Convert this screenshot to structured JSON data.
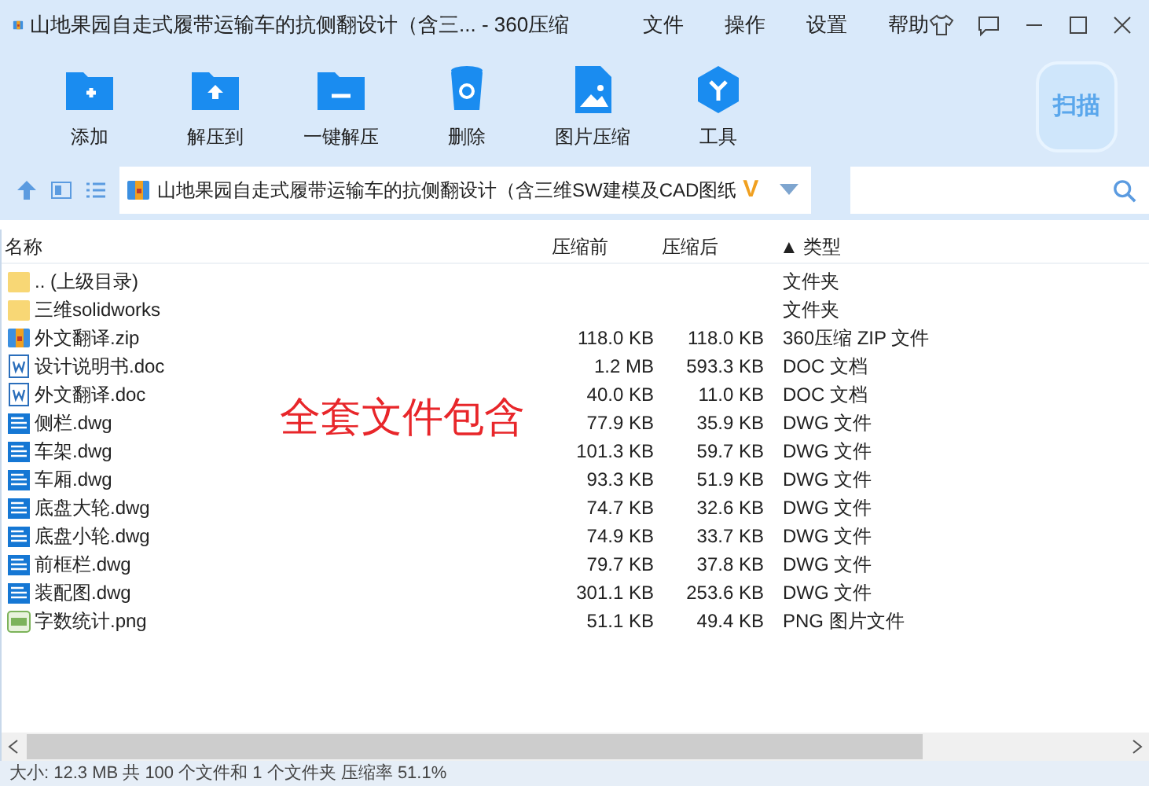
{
  "window": {
    "title": "山地果园自走式履带运输车的抗侧翻设计（含三... - 360压缩"
  },
  "menu": [
    "文件",
    "操作",
    "设置",
    "帮助"
  ],
  "toolbar": [
    {
      "kind": "add",
      "label": "添加"
    },
    {
      "kind": "extract",
      "label": "解压到"
    },
    {
      "kind": "oneclick",
      "label": "一键解压"
    },
    {
      "kind": "delete",
      "label": "删除"
    },
    {
      "kind": "image",
      "label": "图片压缩"
    },
    {
      "kind": "tools",
      "label": "工具"
    }
  ],
  "scan_badge": "扫描",
  "address": {
    "path": "山地果园自走式履带运输车的抗侧翻设计（含三维SW建模及CAD图纸",
    "badge": "V"
  },
  "table": {
    "columns": [
      "名称",
      "压缩前",
      "压缩后",
      "▲ 类型"
    ],
    "rows": [
      {
        "kind": "folder",
        "name": ".. (上级目录)",
        "size": "",
        "packed": "",
        "type": "文件夹"
      },
      {
        "kind": "folder",
        "name": "三维solidworks",
        "size": "",
        "packed": "",
        "type": "文件夹"
      },
      {
        "kind": "zip",
        "name": "外文翻译.zip",
        "size": "118.0 KB",
        "packed": "118.0 KB",
        "type": "360压缩 ZIP 文件"
      },
      {
        "kind": "doc",
        "name": "设计说明书.doc",
        "size": "1.2 MB",
        "packed": "593.3 KB",
        "type": "DOC 文档"
      },
      {
        "kind": "doc",
        "name": "外文翻译.doc",
        "size": "40.0 KB",
        "packed": "11.0 KB",
        "type": "DOC 文档"
      },
      {
        "kind": "dwg",
        "name": "侧栏.dwg",
        "size": "77.9 KB",
        "packed": "35.9 KB",
        "type": "DWG 文件"
      },
      {
        "kind": "dwg",
        "name": "车架.dwg",
        "size": "101.3 KB",
        "packed": "59.7 KB",
        "type": "DWG 文件"
      },
      {
        "kind": "dwg",
        "name": "车厢.dwg",
        "size": "93.3 KB",
        "packed": "51.9 KB",
        "type": "DWG 文件"
      },
      {
        "kind": "dwg",
        "name": "底盘大轮.dwg",
        "size": "74.7 KB",
        "packed": "32.6 KB",
        "type": "DWG 文件"
      },
      {
        "kind": "dwg",
        "name": "底盘小轮.dwg",
        "size": "74.9 KB",
        "packed": "33.7 KB",
        "type": "DWG 文件"
      },
      {
        "kind": "dwg",
        "name": "前框栏.dwg",
        "size": "79.7 KB",
        "packed": "37.8 KB",
        "type": "DWG 文件"
      },
      {
        "kind": "dwg",
        "name": "装配图.dwg",
        "size": "301.1 KB",
        "packed": "253.6 KB",
        "type": "DWG 文件"
      },
      {
        "kind": "png",
        "name": "字数统计.png",
        "size": "51.1 KB",
        "packed": "49.4 KB",
        "type": "PNG 图片文件"
      }
    ]
  },
  "overlay_text": "全套文件包含",
  "status_bar": "大小: 12.3 MB 共 100 个文件和 1 个文件夹 压缩率 51.1%"
}
